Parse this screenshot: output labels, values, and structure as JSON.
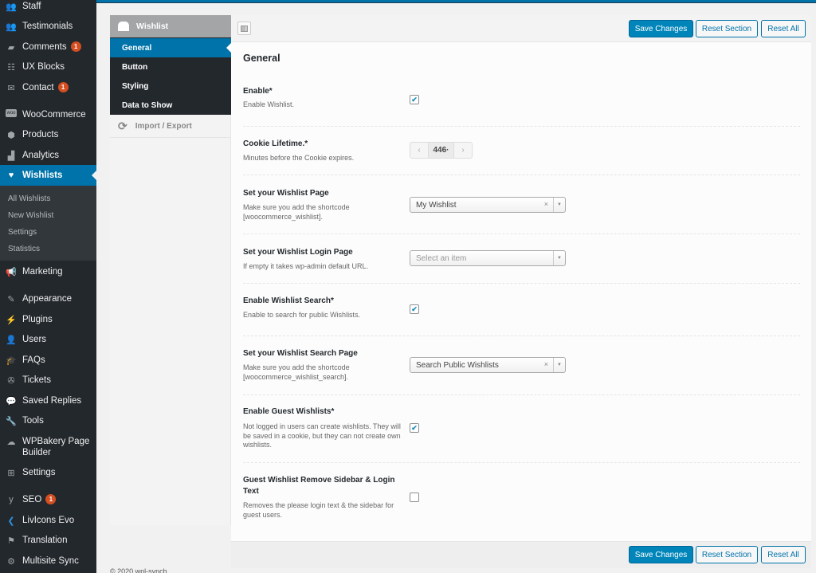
{
  "admin_menu": {
    "items": [
      {
        "label": "Staff",
        "icon": "staff-icon"
      },
      {
        "label": "Testimonials",
        "icon": "testimonials-icon"
      },
      {
        "label": "Comments",
        "icon": "comments-icon",
        "badge": "1"
      },
      {
        "label": "UX Blocks",
        "icon": "ux-blocks-icon"
      },
      {
        "label": "Contact",
        "icon": "contact-icon",
        "badge": "1"
      },
      {
        "label": "WooCommerce",
        "icon": "woocommerce-icon"
      },
      {
        "label": "Products",
        "icon": "products-icon"
      },
      {
        "label": "Analytics",
        "icon": "analytics-icon"
      },
      {
        "label": "Wishlists",
        "icon": "heart-icon",
        "active": true
      },
      {
        "label": "Marketing",
        "icon": "megaphone-icon"
      },
      {
        "label": "Appearance",
        "icon": "brush-icon"
      },
      {
        "label": "Plugins",
        "icon": "plugin-icon"
      },
      {
        "label": "Users",
        "icon": "user-icon"
      },
      {
        "label": "FAQs",
        "icon": "faq-icon"
      },
      {
        "label": "Tickets",
        "icon": "ticket-icon"
      },
      {
        "label": "Saved Replies",
        "icon": "saved-replies-icon"
      },
      {
        "label": "Tools",
        "icon": "wrench-icon"
      },
      {
        "label": "WPBakery Page Builder",
        "icon": "wpbakery-icon"
      },
      {
        "label": "Settings",
        "icon": "settings-icon"
      },
      {
        "label": "SEO",
        "icon": "yoast-icon",
        "badge": "1"
      },
      {
        "label": "LivIcons Evo",
        "icon": "livicons-icon"
      },
      {
        "label": "Translation",
        "icon": "flag-icon"
      },
      {
        "label": "Multisite Sync",
        "icon": "gear-icon"
      }
    ],
    "submenu": [
      "All Wishlists",
      "New Wishlist",
      "Settings",
      "Statistics"
    ]
  },
  "options_panel": {
    "header": "Wishlist",
    "sections": [
      "General",
      "Button",
      "Styling",
      "Data to Show"
    ],
    "active_section": "General",
    "import_export": "Import / Export"
  },
  "toolbar": {
    "save": "Save Changes",
    "reset_section": "Reset Section",
    "reset_all": "Reset All"
  },
  "main": {
    "section_title": "General",
    "fields": [
      {
        "title": "Enable*",
        "desc": "Enable Wishlist.",
        "type": "checkbox",
        "checked": true
      },
      {
        "title": "Cookie Lifetime.*",
        "desc": "Minutes before the Cookie expires.",
        "type": "spinner",
        "value": "446·"
      },
      {
        "title": "Set your Wishlist Page",
        "desc": "Make sure you add the shortcode [woocommerce_wishlist].",
        "type": "select",
        "value": "My Wishlist"
      },
      {
        "title": "Set your Wishlist Login Page",
        "desc": "If empty it takes wp-admin default URL.",
        "type": "select",
        "placeholder": "Select an item"
      },
      {
        "title": "Enable Wishlist Search*",
        "desc": "Enable to search for public Wishlists.",
        "type": "checkbox",
        "checked": true
      },
      {
        "title": "Set your Wishlist Search Page",
        "desc": "Make sure you add the shortcode [woocommerce_wishlist_search].",
        "type": "select",
        "value": "Search Public Wishlists"
      },
      {
        "title": "Enable Guest Wishlists*",
        "desc": "Not logged in users can create wishlists. They will be saved in a cookie, but they can not create own wishlists.",
        "type": "checkbox",
        "checked": true
      },
      {
        "title": "Guest Wishlist Remove Sidebar & Login Text",
        "desc": "Removes the please login text & the sidebar for guest users.",
        "type": "checkbox",
        "checked": false
      }
    ]
  },
  "glyphs": {
    "check": "✔",
    "clear": "×",
    "drop": "▼",
    "prev": "‹",
    "next": "›"
  },
  "footer": "© 2020 wpl-synch"
}
